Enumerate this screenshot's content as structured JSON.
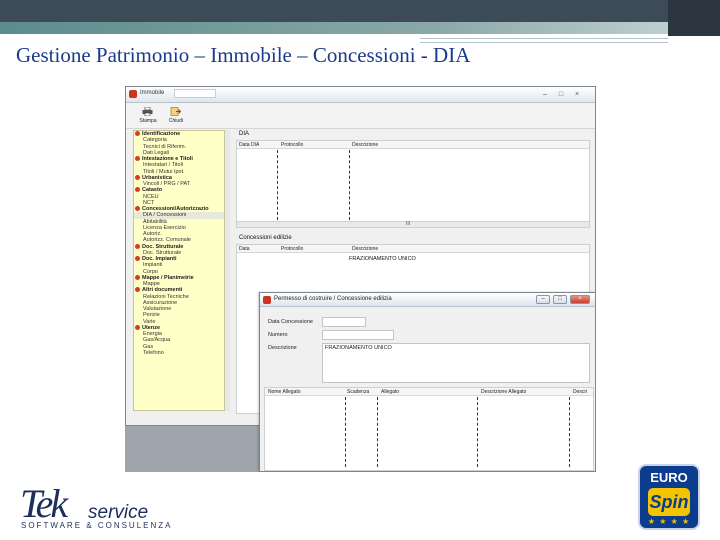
{
  "slide": {
    "title": "Gestione Patrimonio – Immobile – Concessioni - DIA"
  },
  "app_window": {
    "title": "Immobile",
    "title_value": "",
    "controls": [
      "–",
      "□",
      "×"
    ],
    "toolbar": [
      {
        "label": "Stampa",
        "icon": "printer-icon"
      },
      {
        "label": "Chiudi",
        "icon": "exit-icon"
      }
    ],
    "tree": [
      {
        "label": "Identificazione",
        "group": true
      },
      {
        "label": "Categoria",
        "group": false
      },
      {
        "label": "Tecnici di Riferim.",
        "group": false
      },
      {
        "label": "Dati Legali",
        "group": false
      },
      {
        "label": "Intestazione e Titoli",
        "group": true
      },
      {
        "label": "Intestatari / Titoli",
        "group": false
      },
      {
        "label": "Titoli / Mutui Ipot.",
        "group": false
      },
      {
        "label": "Urbanistica",
        "group": true
      },
      {
        "label": "Vincoli / PRG / PAT",
        "group": false
      },
      {
        "label": "Catasto",
        "group": true
      },
      {
        "label": "NCEU",
        "group": false
      },
      {
        "label": "NCT",
        "group": false
      },
      {
        "label": "Concessioni/Autorizzazio",
        "group": true
      },
      {
        "label": "DIA / Concessioni",
        "group": false,
        "selected": true
      },
      {
        "label": "Abitabilità",
        "group": false
      },
      {
        "label": "Licenza Esercizio",
        "group": false
      },
      {
        "label": "Autoriz.",
        "group": false
      },
      {
        "label": "Autorizz. Comunale",
        "group": false
      },
      {
        "label": "Doc. Strutturale",
        "group": true
      },
      {
        "label": "Doc. Strutturale",
        "group": false
      },
      {
        "label": "Doc. Impianti",
        "group": true
      },
      {
        "label": "Impianti",
        "group": false
      },
      {
        "label": "Corpo",
        "group": false
      },
      {
        "label": "Mappe / Planimetrie",
        "group": true
      },
      {
        "label": "Mappe",
        "group": false
      },
      {
        "label": "Altri documenti",
        "group": true
      },
      {
        "label": "Relazioni Tecniche",
        "group": false
      },
      {
        "label": "Assicurazione",
        "group": false
      },
      {
        "label": "Valutazione",
        "group": false
      },
      {
        "label": "Perizie",
        "group": false
      },
      {
        "label": "Varie",
        "group": false
      },
      {
        "label": "Utenze",
        "group": true
      },
      {
        "label": "Energia",
        "group": false
      },
      {
        "label": "Gas/Acqua",
        "group": false
      },
      {
        "label": "Gas",
        "group": false
      },
      {
        "label": "Telefono",
        "group": false
      }
    ],
    "dia_panel": {
      "caption": "DIA",
      "columns": [
        "Data DIA",
        "Protocollo",
        "Descrizione"
      ],
      "scroll_label": "III"
    },
    "concessioni_panel": {
      "caption": "Concessioni edilizie",
      "columns": [
        "Data",
        "Protocollo",
        "Descrizione"
      ],
      "row": {
        "descrizione": "FRAZIONAMENTO UNICO"
      }
    }
  },
  "dialog": {
    "title": "Permesso di costruire / Concessione edilizia",
    "controls": [
      "–",
      "□",
      "×"
    ],
    "fields": [
      {
        "label": "Data Concessione",
        "value": ""
      },
      {
        "label": "Numero",
        "value": ""
      },
      {
        "label": "Descrizione",
        "value": "FRAZIONAMENTO UNICO"
      }
    ],
    "columns": [
      "Nome Allegato",
      "Scadenza",
      "Allegato",
      "Descrizione Allegato",
      "Descri"
    ]
  },
  "logos": {
    "tek_letters": "Tek",
    "tek_service": "service",
    "tek_tagline": "SOFTWARE & CONSULENZA",
    "euro": "EURO",
    "spin": "Spin",
    "stars": "★ ★ ★ ★"
  },
  "colors": {
    "title_blue": "#1a3a8a",
    "tree_yellow": "#ffffc8",
    "header_dark": "#3d4a57",
    "header_teal": "#5c8c8c",
    "eurospin_blue": "#0c3c8e",
    "eurospin_yellow": "#f2c500"
  }
}
